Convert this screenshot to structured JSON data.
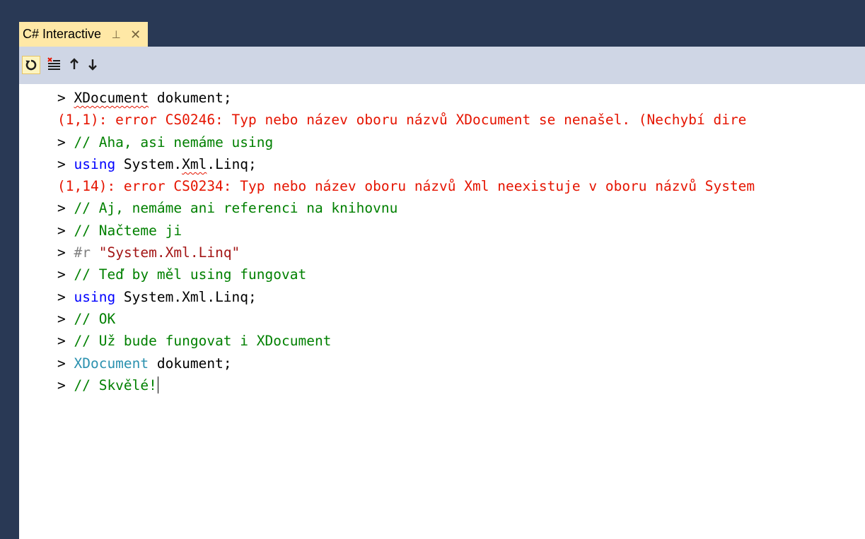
{
  "window": {
    "tab_title": "C# Interactive",
    "pin_glyph": "⊣",
    "close_glyph": "✕"
  },
  "toolbar": {
    "buttons": [
      {
        "name": "reset",
        "icon": "reset-icon"
      },
      {
        "name": "clear",
        "icon": "clear-screen-icon"
      },
      {
        "name": "history-up",
        "icon": "arrow-up-icon"
      },
      {
        "name": "history-down",
        "icon": "arrow-down-icon"
      }
    ]
  },
  "colors": {
    "tab_bg": "#293955",
    "active_tab": "#ffe8a6",
    "toolbar_bg": "#cfd6e5",
    "comment": "#008000",
    "error": "#e51400",
    "keyword": "#0000ff",
    "type": "#2b91af",
    "string": "#a31515"
  },
  "repl": {
    "prompt": "> ",
    "lines": [
      {
        "kind": "input",
        "parts": [
          {
            "t": "XDocument",
            "c": "plain",
            "squiggle": true
          },
          {
            "t": " dokument;",
            "c": "plain"
          }
        ]
      },
      {
        "kind": "error",
        "text": "(1,1): error CS0246: Typ nebo název oboru názvů XDocument se nenašel. (Nechybí dire"
      },
      {
        "kind": "input",
        "parts": [
          {
            "t": "// Aha, asi nemáme using",
            "c": "comment"
          }
        ]
      },
      {
        "kind": "input",
        "parts": [
          {
            "t": "using",
            "c": "keyword"
          },
          {
            "t": " System.",
            "c": "plain"
          },
          {
            "t": "Xml",
            "c": "plain",
            "squiggle": true
          },
          {
            "t": ".Linq;",
            "c": "plain"
          }
        ]
      },
      {
        "kind": "error",
        "text": "(1,14): error CS0234: Typ nebo název oboru názvů Xml neexistuje v oboru názvů System"
      },
      {
        "kind": "input",
        "parts": [
          {
            "t": "// Aj, nemáme ani referenci na knihovnu",
            "c": "comment"
          }
        ]
      },
      {
        "kind": "input",
        "parts": [
          {
            "t": "// Načteme ji",
            "c": "comment"
          }
        ]
      },
      {
        "kind": "input",
        "parts": [
          {
            "t": "#r",
            "c": "preproc"
          },
          {
            "t": " ",
            "c": "plain"
          },
          {
            "t": "\"System.Xml.Linq\"",
            "c": "string"
          }
        ]
      },
      {
        "kind": "input",
        "parts": [
          {
            "t": "// Teď by měl using fungovat",
            "c": "comment"
          }
        ]
      },
      {
        "kind": "input",
        "parts": [
          {
            "t": "using",
            "c": "keyword"
          },
          {
            "t": " System.Xml.Linq;",
            "c": "plain"
          }
        ]
      },
      {
        "kind": "input",
        "parts": [
          {
            "t": "// OK",
            "c": "comment"
          }
        ]
      },
      {
        "kind": "input",
        "parts": [
          {
            "t": "// Už bude fungovat i XDocument",
            "c": "comment"
          }
        ]
      },
      {
        "kind": "input",
        "parts": [
          {
            "t": "XDocument",
            "c": "type"
          },
          {
            "t": " dokument;",
            "c": "plain"
          }
        ]
      },
      {
        "kind": "input",
        "parts": [
          {
            "t": "// Skvělé!",
            "c": "comment"
          }
        ],
        "caret": true
      }
    ]
  }
}
